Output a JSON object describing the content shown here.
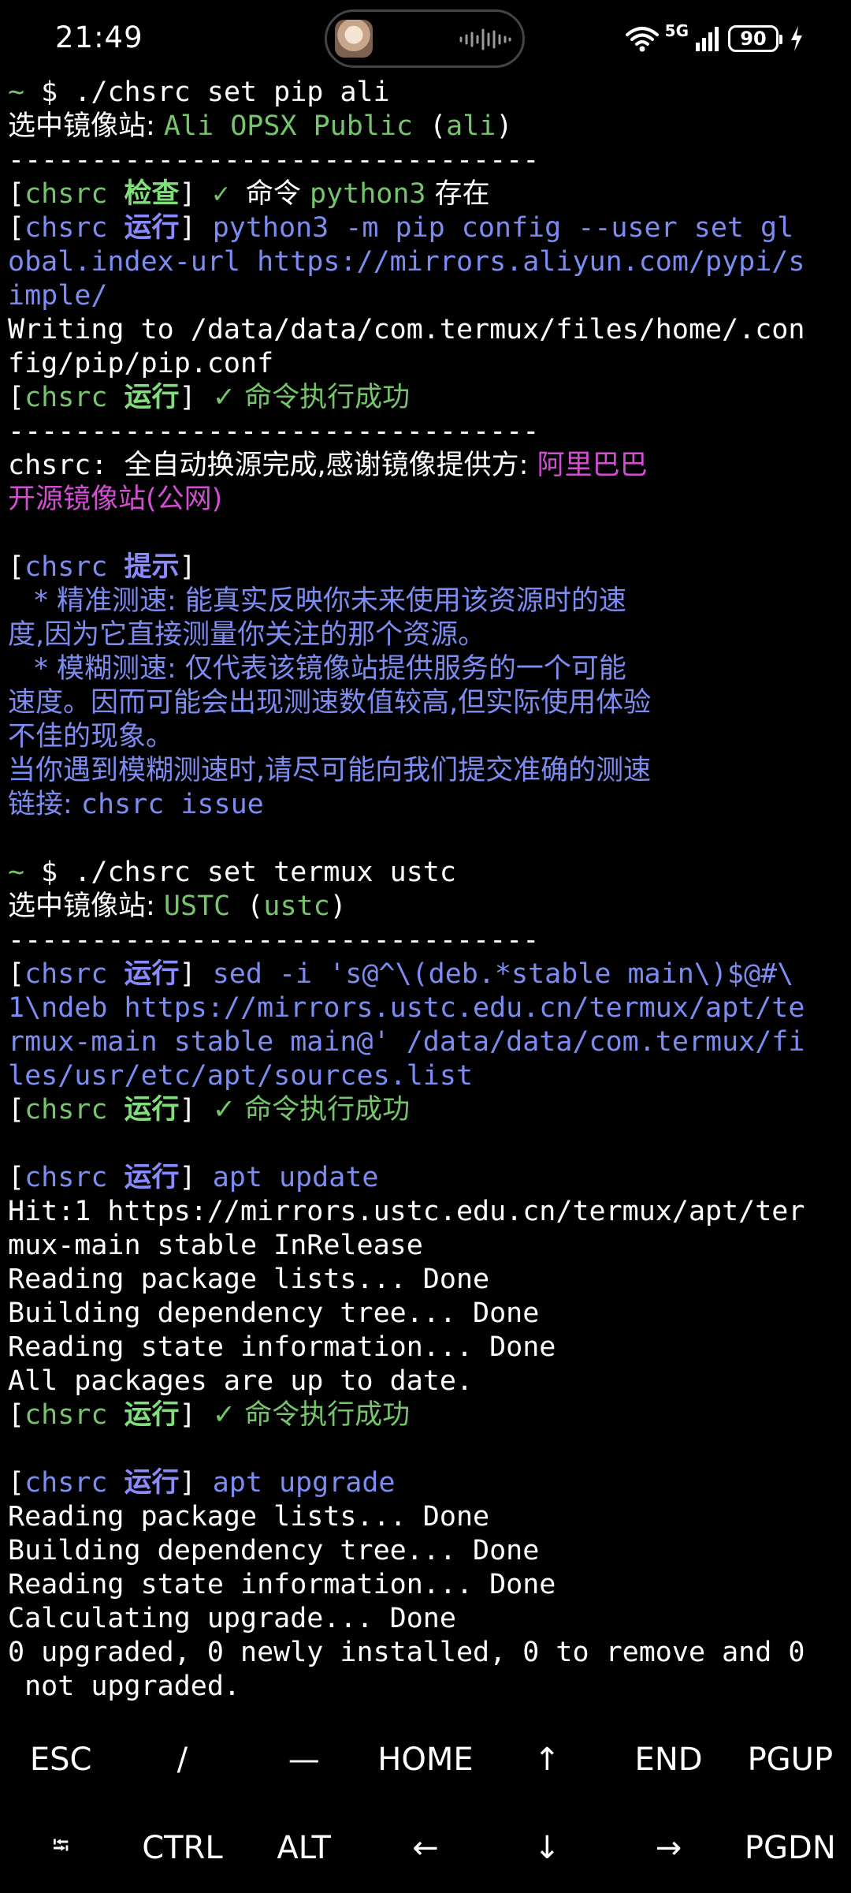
{
  "status_bar": {
    "time": "21:49",
    "network": "5G",
    "battery": "90",
    "icons": [
      "wifi-icon",
      "signal-icon",
      "battery-icon",
      "charging-icon"
    ]
  },
  "terminal": {
    "lines": [
      [
        {
          "t": "~ ",
          "c": "c-green"
        },
        {
          "t": "$ ./chsrc set pip ali",
          "c": ""
        }
      ],
      [
        {
          "t": "选中镜像站: ",
          "c": "cjk"
        },
        {
          "t": "Ali OPSX Public",
          "c": "c-green"
        },
        {
          "t": " (",
          "c": ""
        },
        {
          "t": "ali",
          "c": "c-green"
        },
        {
          "t": ")",
          "c": ""
        }
      ],
      [
        {
          "t": "--------------------------------",
          "c": ""
        }
      ],
      [
        {
          "t": "[",
          "c": ""
        },
        {
          "t": "chsrc ",
          "c": "c-green"
        },
        {
          "t": "检查",
          "c": "c-bgreen cjk"
        },
        {
          "t": "] ",
          "c": ""
        },
        {
          "t": "✓ ",
          "c": "c-green"
        },
        {
          "t": "命令 ",
          "c": "cjk"
        },
        {
          "t": "python3",
          "c": "c-green"
        },
        {
          "t": " 存在",
          "c": "cjk"
        }
      ],
      [
        {
          "t": "[",
          "c": ""
        },
        {
          "t": "chsrc ",
          "c": "c-blue"
        },
        {
          "t": "运行",
          "c": "c-bblue cjk"
        },
        {
          "t": "] ",
          "c": ""
        },
        {
          "t": "python3 -m pip config --user set gl",
          "c": "c-blue"
        }
      ],
      [
        {
          "t": "obal.index-url https://mirrors.aliyun.com/pypi/s",
          "c": "c-blue"
        }
      ],
      [
        {
          "t": "imple/",
          "c": "c-blue"
        }
      ],
      [
        {
          "t": "Writing to /data/data/com.termux/files/home/.con",
          "c": ""
        }
      ],
      [
        {
          "t": "fig/pip/pip.conf",
          "c": ""
        }
      ],
      [
        {
          "t": "[",
          "c": ""
        },
        {
          "t": "chsrc ",
          "c": "c-green"
        },
        {
          "t": "运行",
          "c": "c-bgreen cjk"
        },
        {
          "t": "] ",
          "c": ""
        },
        {
          "t": "✓ 命令执行成功",
          "c": "c-green cjk"
        }
      ],
      [
        {
          "t": "--------------------------------",
          "c": ""
        }
      ],
      [
        {
          "t": "chsrc: ",
          "c": ""
        },
        {
          "t": "全自动换源完成,感谢镜像提供方: ",
          "c": "cjk"
        },
        {
          "t": "阿里巴巴",
          "c": "c-mag cjk"
        }
      ],
      [
        {
          "t": "开源镜像站(公网)",
          "c": "c-mag cjk"
        }
      ],
      [],
      [
        {
          "t": "[",
          "c": ""
        },
        {
          "t": "chsrc ",
          "c": "c-blue"
        },
        {
          "t": "提示",
          "c": "c-bblue cjk"
        },
        {
          "t": "]",
          "c": ""
        }
      ],
      [
        {
          "t": "   * 精准测速: 能真实反映你未来使用该资源时的速",
          "c": "c-blue cjk"
        }
      ],
      [
        {
          "t": "度,因为它直接测量你关注的那个资源。",
          "c": "c-blue cjk"
        }
      ],
      [
        {
          "t": "   * 模糊测速: 仅代表该镜像站提供服务的一个可能",
          "c": "c-blue cjk"
        }
      ],
      [
        {
          "t": "速度。因而可能会出现测速数值较高,但实际使用体验",
          "c": "c-blue cjk"
        }
      ],
      [
        {
          "t": "不佳的现象。",
          "c": "c-blue cjk"
        }
      ],
      [
        {
          "t": "当你遇到模糊测速时,请尽可能向我们提交准确的测速",
          "c": "c-blue cjk"
        }
      ],
      [
        {
          "t": "链接: ",
          "c": "c-blue cjk"
        },
        {
          "t": "chsrc issue",
          "c": "c-blue"
        }
      ],
      [],
      [
        {
          "t": "~ ",
          "c": "c-green"
        },
        {
          "t": "$ ./chsrc set termux ustc",
          "c": ""
        }
      ],
      [
        {
          "t": "选中镜像站: ",
          "c": "cjk"
        },
        {
          "t": "USTC",
          "c": "c-green"
        },
        {
          "t": " (",
          "c": ""
        },
        {
          "t": "ustc",
          "c": "c-green"
        },
        {
          "t": ")",
          "c": ""
        }
      ],
      [
        {
          "t": "--------------------------------",
          "c": ""
        }
      ],
      [
        {
          "t": "[",
          "c": ""
        },
        {
          "t": "chsrc ",
          "c": "c-blue"
        },
        {
          "t": "运行",
          "c": "c-bblue cjk"
        },
        {
          "t": "] ",
          "c": ""
        },
        {
          "t": "sed -i 's@^\\(deb.*stable main\\)$@#\\",
          "c": "c-blue"
        }
      ],
      [
        {
          "t": "1\\ndeb https://mirrors.ustc.edu.cn/termux/apt/te",
          "c": "c-blue"
        }
      ],
      [
        {
          "t": "rmux-main stable main@' /data/data/com.termux/fi",
          "c": "c-blue"
        }
      ],
      [
        {
          "t": "les/usr/etc/apt/sources.list",
          "c": "c-blue"
        }
      ],
      [
        {
          "t": "[",
          "c": ""
        },
        {
          "t": "chsrc ",
          "c": "c-green"
        },
        {
          "t": "运行",
          "c": "c-bgreen cjk"
        },
        {
          "t": "] ",
          "c": ""
        },
        {
          "t": "✓ 命令执行成功",
          "c": "c-green cjk"
        }
      ],
      [],
      [
        {
          "t": "[",
          "c": ""
        },
        {
          "t": "chsrc ",
          "c": "c-blue"
        },
        {
          "t": "运行",
          "c": "c-bblue cjk"
        },
        {
          "t": "] ",
          "c": ""
        },
        {
          "t": "apt update",
          "c": "c-blue"
        }
      ],
      [
        {
          "t": "Hit:1 https://mirrors.ustc.edu.cn/termux/apt/ter",
          "c": ""
        }
      ],
      [
        {
          "t": "mux-main stable InRelease",
          "c": ""
        }
      ],
      [
        {
          "t": "Reading package lists... Done",
          "c": ""
        }
      ],
      [
        {
          "t": "Building dependency tree... Done",
          "c": ""
        }
      ],
      [
        {
          "t": "Reading state information... Done",
          "c": ""
        }
      ],
      [
        {
          "t": "All packages are up to date.",
          "c": ""
        }
      ],
      [
        {
          "t": "[",
          "c": ""
        },
        {
          "t": "chsrc ",
          "c": "c-green"
        },
        {
          "t": "运行",
          "c": "c-bgreen cjk"
        },
        {
          "t": "] ",
          "c": ""
        },
        {
          "t": "✓ 命令执行成功",
          "c": "c-green cjk"
        }
      ],
      [],
      [
        {
          "t": "[",
          "c": ""
        },
        {
          "t": "chsrc ",
          "c": "c-blue"
        },
        {
          "t": "运行",
          "c": "c-bblue cjk"
        },
        {
          "t": "] ",
          "c": ""
        },
        {
          "t": "apt upgrade",
          "c": "c-blue"
        }
      ],
      [
        {
          "t": "Reading package lists... Done",
          "c": ""
        }
      ],
      [
        {
          "t": "Building dependency tree... Done",
          "c": ""
        }
      ],
      [
        {
          "t": "Reading state information... Done",
          "c": ""
        }
      ],
      [
        {
          "t": "Calculating upgrade... Done",
          "c": ""
        }
      ],
      [
        {
          "t": "0 upgraded, 0 newly installed, 0 to remove and 0",
          "c": ""
        }
      ],
      [
        {
          "t": " not upgraded.",
          "c": ""
        }
      ]
    ]
  },
  "extra_keys": {
    "row1": [
      {
        "label": "ESC",
        "name": "esc-key"
      },
      {
        "label": "/",
        "name": "slash-key"
      },
      {
        "label": "—",
        "name": "dash-key"
      },
      {
        "label": "HOME",
        "name": "home-key"
      },
      {
        "label": "↑",
        "name": "arrow-up-key"
      },
      {
        "label": "END",
        "name": "end-key"
      },
      {
        "label": "PGUP",
        "name": "pgup-key"
      }
    ],
    "row2": [
      {
        "label": "⭾",
        "name": "tab-key"
      },
      {
        "label": "CTRL",
        "name": "ctrl-key"
      },
      {
        "label": "ALT",
        "name": "alt-key"
      },
      {
        "label": "←",
        "name": "arrow-left-key"
      },
      {
        "label": "↓",
        "name": "arrow-down-key"
      },
      {
        "label": "→",
        "name": "arrow-right-key"
      },
      {
        "label": "PGDN",
        "name": "pgdn-key"
      }
    ]
  }
}
